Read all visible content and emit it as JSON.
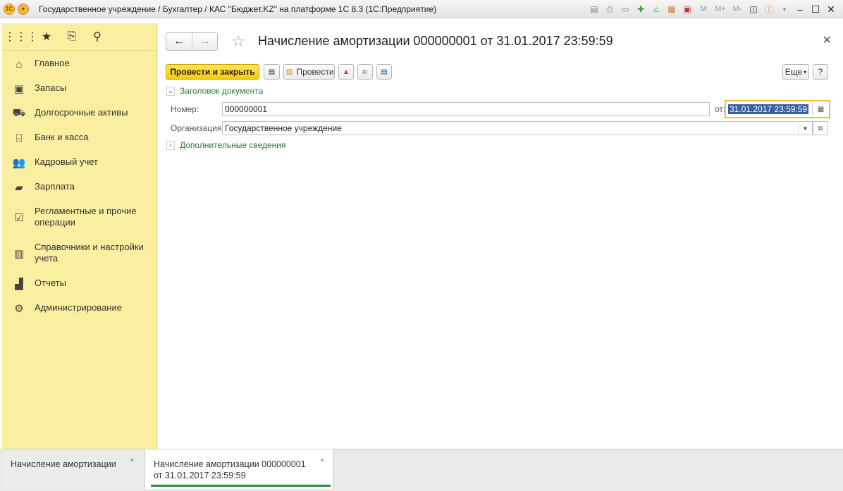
{
  "window": {
    "title": "Государственное учреждение / Бухгалтер / КАС \"Бюджет.KZ\" на платформе 1С 8.3  (1С:Предприятие)",
    "logo": "1С",
    "toolbar_icons": [
      "save-icon",
      "print-icon",
      "preview-icon",
      "add-favorite-icon",
      "history-icon",
      "calculator-icon",
      "calendar-icon"
    ],
    "memory_buttons": [
      "M",
      "M+",
      "M-"
    ]
  },
  "sidebar": {
    "top_icons": [
      "apps-grid-icon",
      "favorites-star-icon",
      "history-icon",
      "search-icon"
    ],
    "items": [
      {
        "label": "Главное",
        "icon": "home-icon"
      },
      {
        "label": "Запасы",
        "icon": "warehouse-icon"
      },
      {
        "label": "Долгосрочные активы",
        "icon": "tractor-icon"
      },
      {
        "label": "Банк и касса",
        "icon": "bank-icon"
      },
      {
        "label": "Кадровый учет",
        "icon": "people-icon"
      },
      {
        "label": "Зарплата",
        "icon": "salary-icon"
      },
      {
        "label": "Регламентные и прочие операции",
        "icon": "checkbox-icon"
      },
      {
        "label": "Справочники и настройки учета",
        "icon": "directory-icon"
      },
      {
        "label": "Отчеты",
        "icon": "chart-icon"
      },
      {
        "label": "Администрирование",
        "icon": "gear-icon"
      }
    ]
  },
  "document": {
    "title": "Начисление амортизации 000000001 от 31.01.2017 23:59:59",
    "buttons": {
      "post_and_close": "Провести и закрыть",
      "post": "Провести",
      "more": "Еще",
      "help": "?"
    },
    "header_group": "Заголовок документа",
    "number_label": "Номер:",
    "number_value": "000000001",
    "date_label": "от:",
    "date_value": "31.01.2017 23:59:59",
    "organization_label": "Организация:",
    "organization_value": "Государственное учреждение",
    "extra_group": "Дополнительные сведения"
  },
  "tabs": [
    {
      "label": "Начисление амортизации",
      "active": false
    },
    {
      "label": "Начисление амортизации 000000001 от 31.01.2017 23:59:59",
      "active": true
    }
  ],
  "colors": {
    "sidebar_bg": "#faeea0",
    "primary_button": "#f3cc10",
    "group_link": "#2b7a3d",
    "focus_border": "#f3c132",
    "selection": "#3b5da6"
  }
}
